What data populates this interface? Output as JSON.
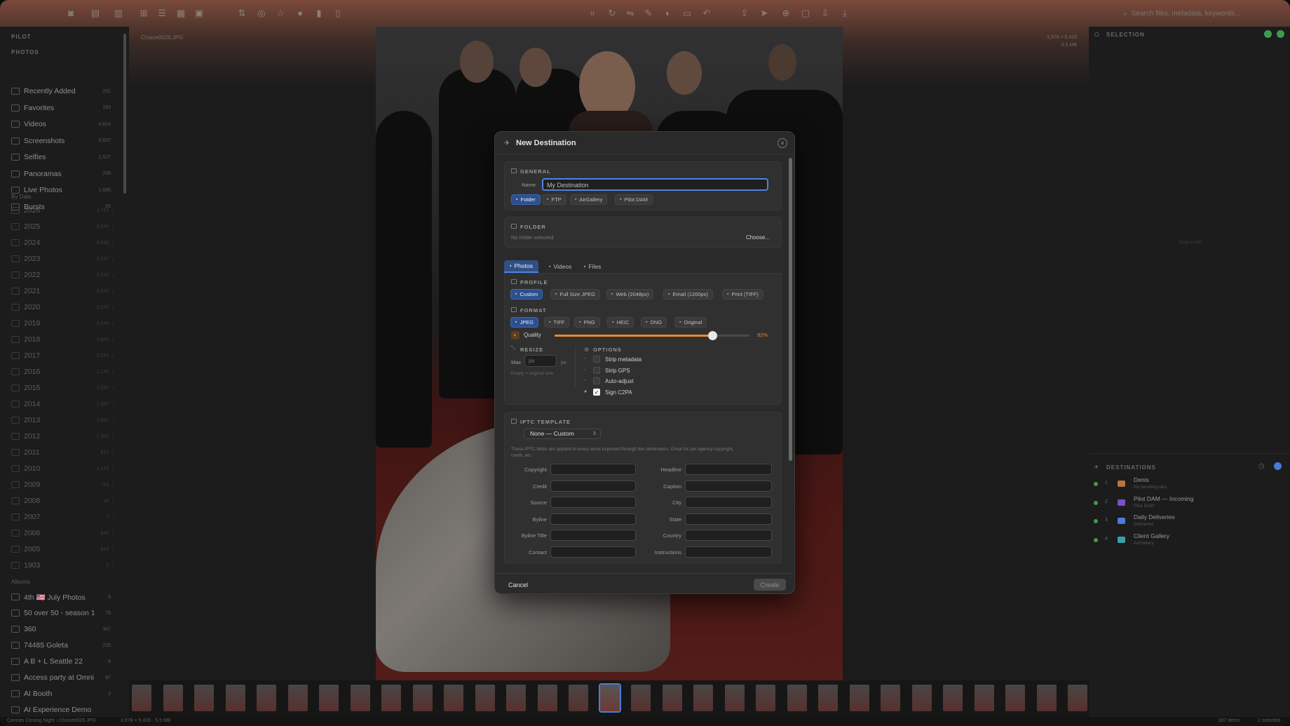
{
  "toolbar": {
    "search_placeholder": "Search files, metadata, keywords..."
  },
  "sidebar": {
    "app_title": "PILOT",
    "photos_header": "PHOTOS",
    "photos": [
      {
        "label": "Recently Added",
        "count": "291",
        "icon": "clock-icon"
      },
      {
        "label": "Favorites",
        "count": "183",
        "icon": "heart-icon"
      },
      {
        "label": "Videos",
        "count": "4,824",
        "icon": "video-icon"
      },
      {
        "label": "Screenshots",
        "count": "4,507",
        "icon": "screenshot-icon"
      },
      {
        "label": "Selfies",
        "count": "2,527",
        "icon": "person-icon"
      },
      {
        "label": "Panoramas",
        "count": "209",
        "icon": "panorama-icon"
      },
      {
        "label": "Live Photos",
        "count": "1,685",
        "icon": "live-icon"
      },
      {
        "label": "Bursts",
        "count": "93",
        "icon": "bursts-icon"
      }
    ],
    "by_date_header": "By Date",
    "years": [
      {
        "label": "2026",
        "count": "3,753"
      },
      {
        "label": "2025",
        "count": "5,644"
      },
      {
        "label": "2024",
        "count": "6,698"
      },
      {
        "label": "2023",
        "count": "5,347"
      },
      {
        "label": "2022",
        "count": "6,525"
      },
      {
        "label": "2021",
        "count": "5,834"
      },
      {
        "label": "2020",
        "count": "3,109"
      },
      {
        "label": "2019",
        "count": "6,548"
      },
      {
        "label": "2018",
        "count": "5,805"
      },
      {
        "label": "2017",
        "count": "3,551"
      },
      {
        "label": "2016",
        "count": "2,166"
      },
      {
        "label": "2015",
        "count": "2,050"
      },
      {
        "label": "2014",
        "count": "1,387"
      },
      {
        "label": "2013",
        "count": "2,660"
      },
      {
        "label": "2012",
        "count": "1,300"
      },
      {
        "label": "2011",
        "count": "812"
      },
      {
        "label": "2010",
        "count": "1,010"
      },
      {
        "label": "2009",
        "count": "116"
      },
      {
        "label": "2008",
        "count": "38"
      },
      {
        "label": "2007",
        "count": "3"
      },
      {
        "label": "2006",
        "count": "830"
      },
      {
        "label": "2005",
        "count": "816"
      },
      {
        "label": "1903",
        "count": "1"
      }
    ],
    "albums_header": "Albums",
    "albums": [
      {
        "label": "4th 🇺🇸 July Photos",
        "count": "9"
      },
      {
        "label": "50 over 50 - season 1",
        "count": "76"
      },
      {
        "label": "360",
        "count": "347"
      },
      {
        "label": "74485 Goleta",
        "count": "228"
      },
      {
        "label": "A B + L Seattle 22",
        "count": "8"
      },
      {
        "label": "Access party at Omni",
        "count": "87"
      },
      {
        "label": "AI Booth",
        "count": "3"
      },
      {
        "label": "AI Experience Demo",
        "count": ""
      }
    ]
  },
  "viewer": {
    "filename": "Choice0026.JPG",
    "dimensions": "3,978 × 5,426",
    "filesize": "5.5 MB"
  },
  "right_panel": {
    "selection_header": "SELECTION",
    "empty_hint": "Drag to add",
    "destinations_header": "DESTINATIONS",
    "destinations": [
      {
        "num": "1",
        "name": "Denis",
        "sub": "No pending jobs",
        "color": "#b8743a"
      },
      {
        "num": "2",
        "name": "Pilot DAM — Incoming",
        "sub": "Pilot DAM",
        "color": "#7d4fc4"
      },
      {
        "num": "3",
        "name": "Daily Deliveries",
        "sub": "Deliveries",
        "color": "#4b7cd6"
      },
      {
        "num": "4",
        "name": "Client Gallery",
        "sub": "AirGallery",
        "color": "#3aa0a8"
      }
    ]
  },
  "statusbar": {
    "path": "Cannes Closing Night › Choice0026.JPG",
    "meta": "3,978 × 5,426 · 5.5 MB",
    "items": "307 items",
    "selected": "1 selected"
  },
  "dialog": {
    "title": "New Destination",
    "general": {
      "header": "GENERAL",
      "name_label": "Name",
      "name_placeholder": "My Destination",
      "types": [
        {
          "label": "Folder",
          "icon": "folder-icon",
          "active": true
        },
        {
          "label": "FTP",
          "icon": "globe-icon",
          "active": false
        },
        {
          "label": "AirGallery",
          "icon": "gallery-icon",
          "active": false
        },
        {
          "label": "Pilot DAM",
          "icon": "dam-icon",
          "active": false
        }
      ]
    },
    "folder": {
      "header": "FOLDER",
      "status": "No folder selected",
      "choose_label": "Choose..."
    },
    "tabs": [
      {
        "label": "Photos",
        "active": true
      },
      {
        "label": "Videos",
        "active": false
      },
      {
        "label": "Files",
        "active": false
      }
    ],
    "profile": {
      "header": "PROFILE",
      "options": [
        {
          "label": "Custom",
          "active": true
        },
        {
          "label": "Full Size JPEG",
          "active": false
        },
        {
          "label": "Web (2048px)",
          "active": false
        },
        {
          "label": "Email (1200px)",
          "active": false
        },
        {
          "label": "Print (TIFF)",
          "active": false
        }
      ]
    },
    "format": {
      "header": "FORMAT",
      "options": [
        {
          "label": "JPEG",
          "active": true
        },
        {
          "label": "TIFF",
          "active": false
        },
        {
          "label": "PNG",
          "active": false
        },
        {
          "label": "HEIC",
          "active": false
        },
        {
          "label": "DNG",
          "active": false
        },
        {
          "label": "Original",
          "active": false
        }
      ],
      "quality_label": "Quality",
      "quality_value": "92%",
      "quality_fraction": 0.92
    },
    "resize": {
      "header": "RESIZE",
      "max_label": "Max",
      "placeholder": "px",
      "unit": "px",
      "hint": "Empty = original size"
    },
    "options": {
      "header": "OPTIONS",
      "items": [
        {
          "label": "Strip metadata",
          "checked": false
        },
        {
          "label": "Strip GPS",
          "checked": false
        },
        {
          "label": "Auto-adjust",
          "checked": false
        },
        {
          "label": "Sign C2PA",
          "checked": true
        }
      ]
    },
    "iptc": {
      "header": "IPTC TEMPLATE",
      "template": "None — Custom",
      "description": "These IPTC fields are applied to every asset exported through this destination. Great for per-agency copyright, credit, etc.",
      "left_fields": [
        "Copyright",
        "Credit",
        "Source",
        "Byline",
        "Byline Title",
        "Contact"
      ],
      "right_fields": [
        "Headline",
        "Caption",
        "City",
        "State",
        "Country",
        "Instructions"
      ]
    },
    "cancel_label": "Cancel",
    "create_label": "Create"
  }
}
